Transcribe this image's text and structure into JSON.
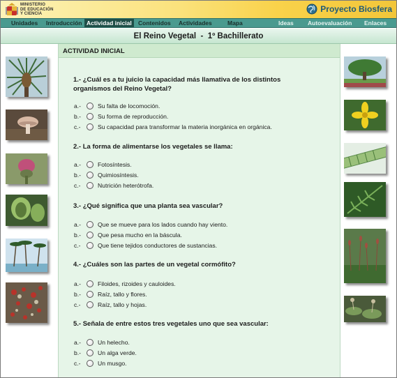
{
  "header": {
    "ministry_lines": [
      "MINISTERIO",
      "DE EDUCACIÓN",
      "Y CIENCIA"
    ],
    "brand": "Proyecto Biosfera"
  },
  "nav": {
    "items": [
      {
        "label": "Unidades"
      },
      {
        "label": "Introducción"
      },
      {
        "label": "Actividad inicial"
      },
      {
        "label": "Contenidos"
      },
      {
        "label": "Actividades"
      },
      {
        "label": "Mapa"
      },
      {
        "label": "Ideas"
      },
      {
        "label": "Autoevaluación"
      },
      {
        "label": "Enlaces"
      }
    ],
    "active": "Actividad inicial"
  },
  "page": {
    "title": "El Reino Vegetal  -  1º Bachillerato",
    "section": "ACTIVIDAD INICIAL"
  },
  "questions": [
    {
      "text": "1.- ¿Cuál es a tu juicio la capacidad más llamativa de los distintos organismos del Reino Vegetal?",
      "options": [
        {
          "letter": "a.-",
          "text": "Su falta de locomoción."
        },
        {
          "letter": "b.-",
          "text": "Su forma de reproducción."
        },
        {
          "letter": "c.-",
          "text": "Su capacidad para transformar la materia inorgánica en orgánica."
        }
      ]
    },
    {
      "text": "2.- La forma de alimentarse los vegetales se llama:",
      "options": [
        {
          "letter": "a.-",
          "text": "Fotosíntesis."
        },
        {
          "letter": "b.-",
          "text": "Quimiosíntesis."
        },
        {
          "letter": "c.-",
          "text": "Nutrición heterótrofa."
        }
      ]
    },
    {
      "text": "3.- ¿Qué significa que una planta sea vascular?",
      "options": [
        {
          "letter": "a.-",
          "text": "Que se mueve para los lados cuando hay viento."
        },
        {
          "letter": "b.-",
          "text": "Que pesa mucho en la báscula."
        },
        {
          "letter": "c.-",
          "text": "Que tiene tejidos conductores de sustancias."
        }
      ]
    },
    {
      "text": "4.- ¿Cuáles son las partes de un vegetal cormófito?",
      "options": [
        {
          "letter": "a.-",
          "text": "Filoides, rizoides y cauloides."
        },
        {
          "letter": "b.-",
          "text": "Raíz, tallo y flores."
        },
        {
          "letter": "c.-",
          "text": "Raíz, tallo y hojas."
        }
      ]
    },
    {
      "text": "5.- Señala de entre estos tres vegetales uno que sea vascular:",
      "options": [
        {
          "letter": "a.-",
          "text": "Un helecho."
        },
        {
          "letter": "b.-",
          "text": "Un alga verde."
        },
        {
          "letter": "c.-",
          "text": "Un musgo."
        }
      ]
    }
  ],
  "images": {
    "left": [
      "pine-tree-photo",
      "mushroom-photo",
      "thistle-flower-photo",
      "carnivorous-plant-photo",
      "palm-trees-photo",
      "red-lichen-photo"
    ],
    "right": [
      "tree-photo",
      "yellow-flower-photo",
      "green-algae-photo",
      "fern-photo",
      "moss-sporophytes-photo",
      "liverwort-photo"
    ]
  },
  "colors": {
    "nav_bg": "#4a9a8f",
    "nav_active": "#1f4f48",
    "content_bg": "#e6f5e8",
    "brand": "#1e5a78"
  }
}
